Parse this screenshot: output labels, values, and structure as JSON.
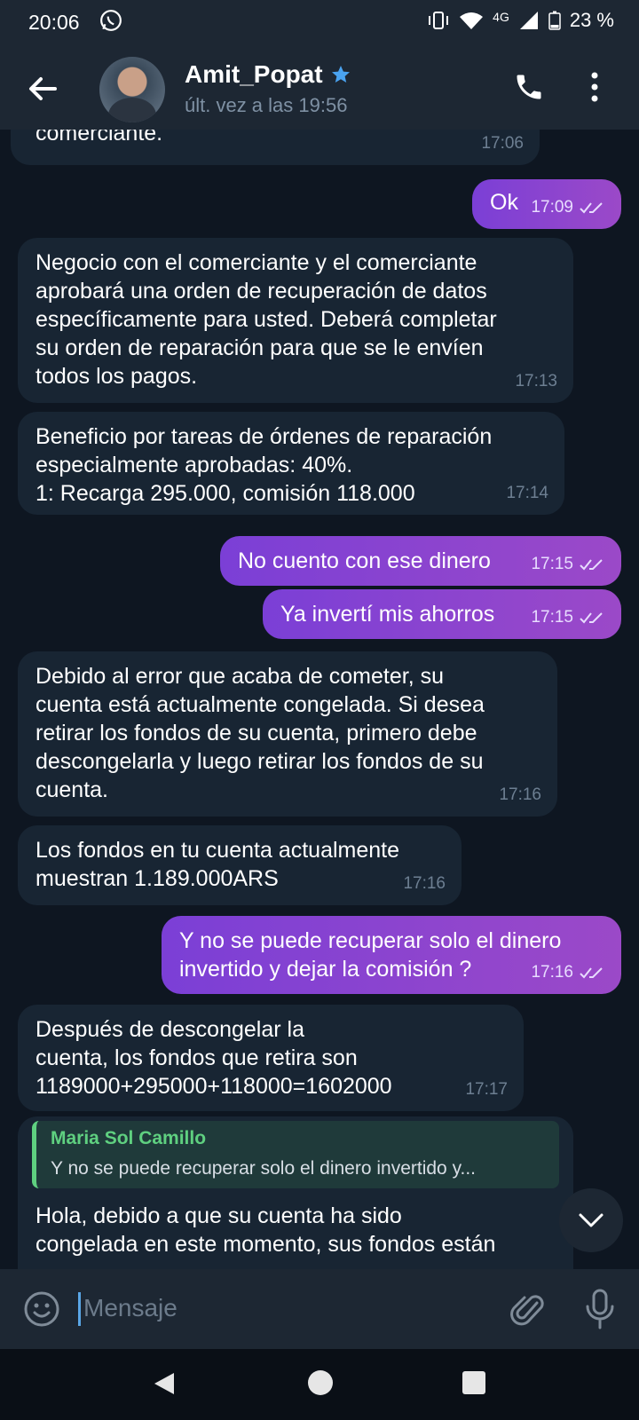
{
  "status_bar": {
    "time": "20:06",
    "network": "4G",
    "battery": "23 %"
  },
  "header": {
    "contact_name": "Amit_Popat",
    "last_seen": "últ. vez a las 19:56"
  },
  "messages": [
    {
      "direction": "in",
      "text": "comerciante.",
      "time": "17:06"
    },
    {
      "direction": "out",
      "text": "Ok",
      "time": "17:09"
    },
    {
      "direction": "in",
      "text": "Negocio con el comerciante y el comerciante\naprobará una orden de recuperación de datos\nespecíficamente para usted. Deberá completar\nsu orden de reparación para que se le envíen\ntodos los pagos.",
      "time": "17:13"
    },
    {
      "direction": "in",
      "text": "Beneficio por tareas de órdenes de reparación\nespecialmente aprobadas: 40%.\n1: Recarga 295.000, comisión 118.000",
      "time": "17:14"
    },
    {
      "direction": "out",
      "text": "No cuento con ese dinero",
      "time": "17:15"
    },
    {
      "direction": "out",
      "text": "Ya invertí mis ahorros",
      "time": "17:15"
    },
    {
      "direction": "in",
      "text": "Debido al error que acaba de cometer, su\ncuenta está actualmente congelada. Si desea\nretirar los fondos de su cuenta, primero debe\ndescongelarla y luego retirar los fondos de su\ncuenta.",
      "time": "17:16"
    },
    {
      "direction": "in",
      "text": "Los fondos en tu cuenta actualmente\nmuestran 1.189.000ARS",
      "time": "17:16"
    },
    {
      "direction": "out",
      "text": "Y no se puede recuperar solo el dinero\ninvertido y dejar la comisión ?",
      "time": "17:16"
    },
    {
      "direction": "in",
      "text": "Después de descongelar la\ncuenta, los fondos que retira son\n1189000+295000+118000=1602000",
      "time": "17:17"
    },
    {
      "direction": "in",
      "text": "Hola, debido a que su cuenta ha sido\ncongelada en este momento, sus fondos están",
      "time": ""
    }
  ],
  "reply_quote": {
    "name": "Maria Sol Camillo",
    "text": "Y no se puede recuperar solo el dinero invertido y..."
  },
  "input": {
    "placeholder": "Mensaje"
  },
  "colors": {
    "background": "#0e1621",
    "incoming_bubble": "#182533",
    "outgoing_bubble": "#8a44cf",
    "accent": "#5aa6e6",
    "quote_accent": "#5fd080"
  }
}
